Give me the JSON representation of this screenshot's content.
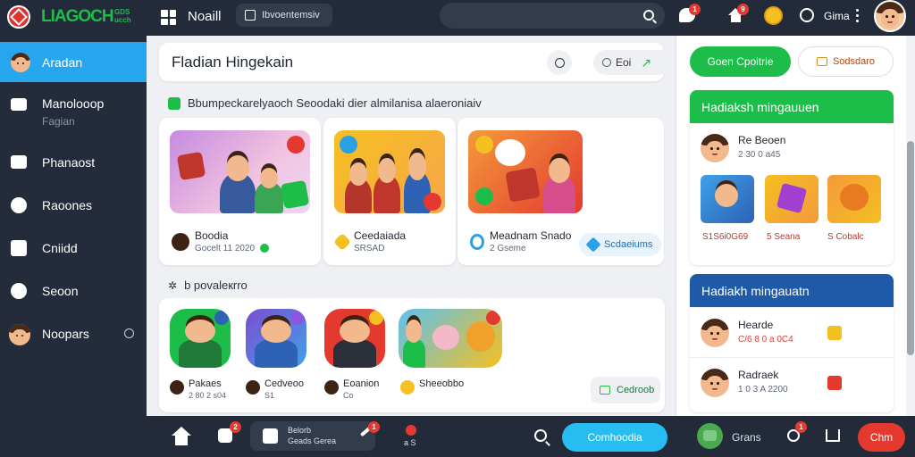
{
  "brand": {
    "logo_text": "LIAGOCH",
    "logo_sub_line1": "GDS",
    "logo_sub_line2": "ucch"
  },
  "topbar": {
    "nav_label": "Noaill",
    "tab_label": "Ibvoentemsiv",
    "user_label": "Gima",
    "chat_badge": "1",
    "home_badge": "9"
  },
  "sidebar": {
    "items": [
      {
        "label": "Aradan",
        "icon": "profile-avatar-icon"
      },
      {
        "label": "Manolooop",
        "sub": "Fagian",
        "icon": "mail-icon"
      },
      {
        "label": "Phanaost",
        "icon": "chat-icon"
      },
      {
        "label": "Raoones",
        "icon": "people-icon"
      },
      {
        "label": "Cniidd",
        "icon": "home-icon"
      },
      {
        "label": "Seoon",
        "icon": "gear-icon"
      },
      {
        "label": "Noopars",
        "icon": "user-avatar-icon"
      }
    ]
  },
  "main": {
    "header_title": "Fladian Hingekain",
    "header_button": "Eoi",
    "section1_title": "Bbumpeckarelyaoch Seoodaki dier almilanisa alaeroniaiv",
    "section2_title": "b povaleкrro",
    "cards": [
      {
        "title": "Boodia",
        "meta": "Gocelt 11 2020",
        "tag_color": "#1dbd4a"
      },
      {
        "title": "Ceedaiada",
        "meta": "SRSAD",
        "tag_color": "#f5c021"
      },
      {
        "title": "Meadnam Snado",
        "meta": "2 Gseme",
        "button": "Scdaeiums"
      }
    ],
    "recommended": [
      {
        "title": "Pakaes",
        "meta": "2 80 2 s04"
      },
      {
        "title": "Cedveoo",
        "meta": "S1"
      },
      {
        "title": "Eoanion",
        "meta": "Co"
      },
      {
        "title": "Sheeobbo",
        "meta": ""
      }
    ],
    "rec_button": "Cedroob"
  },
  "right_panel": {
    "pill_green": "Goen Cpoitrie",
    "pill_outline": "Sodsdaro",
    "panel1": {
      "title": "Hadiaksh mingauuen",
      "row_name": "Re Beoen",
      "row_sub": "2 30 0 a45",
      "tiles": [
        "S1S6i0G69",
        "5 Seana",
        "S Cobalc"
      ]
    },
    "panel2": {
      "title": "Hadiakh mingauatn",
      "rows": [
        {
          "name": "Hearde",
          "sub": "C/6 8 0 a 0C4"
        },
        {
          "name": "Radraek",
          "sub": "1 0 3 A 2200"
        }
      ]
    }
  },
  "bottombar": {
    "badge1": "2",
    "card_line1": "Belorb",
    "card_line2": "Geads Gerea",
    "card_badge": "1",
    "label_after_card": "a S",
    "blue_button": "Comhoodia",
    "avatar_label": "Grans",
    "badge2": "1",
    "red_button": "Chm"
  }
}
